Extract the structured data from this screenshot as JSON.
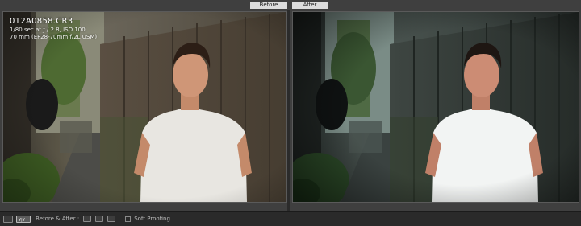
{
  "app": {
    "mode": "Before & After comparison"
  },
  "panes": {
    "before_label": "Before",
    "after_label": "After"
  },
  "info_overlay": {
    "filename": "012A0858.CR3",
    "exposure": "1/80 sec at ƒ / 2.8, ISO 100",
    "lens": "70 mm (EF28-70mm f/2L USM)"
  },
  "toolbar": {
    "view_label": "Before & After :",
    "soft_proofing_label": "Soft Proofing"
  },
  "colors": {
    "background": "#3f3f3f",
    "toolbar_bg": "#2a2a2a",
    "label_bg": "#dcdcdc"
  },
  "icons": [
    "loupe-view-icon",
    "compare-view-icon",
    "swap-icon",
    "copy-settings-icon",
    "copy-after-icon"
  ]
}
